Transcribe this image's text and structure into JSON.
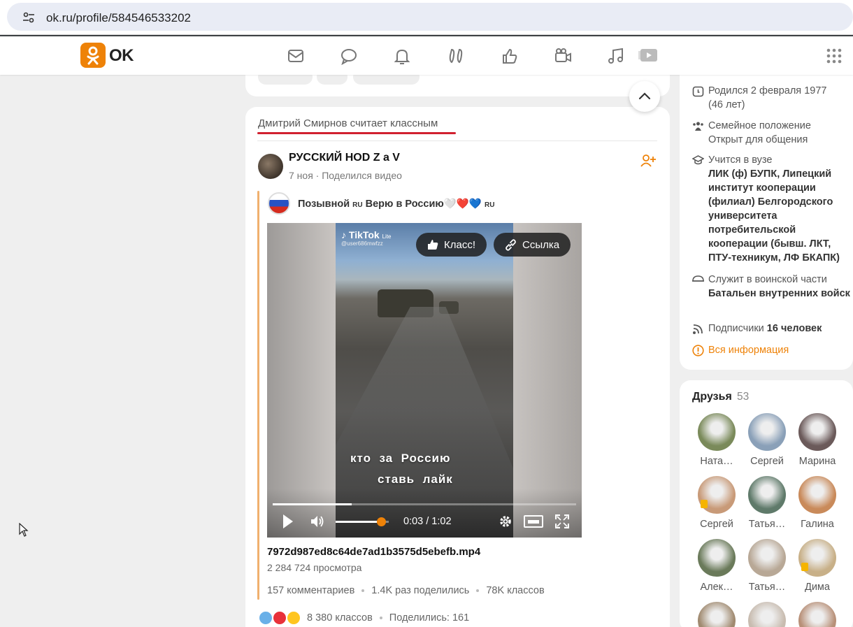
{
  "browser": {
    "url": "ok.ru/profile/584546533202",
    "site_settings_icon": "tune-icon"
  },
  "header": {
    "logo_text": "OK",
    "brand_color": "#ee8208",
    "nav_icons": [
      "messages-icon",
      "discussions-icon",
      "notifications-icon",
      "guests-icon",
      "events-icon",
      "friends-video-icon",
      "music-icon",
      "video-icon"
    ],
    "apps_icon": "apps-grid-icon"
  },
  "post": {
    "context_label": "Дмитрий Смирнов считает классным",
    "author": "РУССКИЙ HOD Z a V",
    "date": "7 ноя",
    "action": "Поделился видео",
    "repost": {
      "author_prefix": "Позывной",
      "author_sup1": "RU",
      "author_main": "Верю в Россию",
      "author_hearts": "🤍❤️💙",
      "author_sup2": "RU"
    },
    "video": {
      "watermark": "TikTok",
      "watermark_sub": "Lite",
      "watermark_user": "@user686mwfzz",
      "like_button": "Класс!",
      "link_button": "Ссылка",
      "caption_line1": "кто  за  Россию",
      "caption_line2": "ставь  лайк",
      "time": "0:03 / 1:02",
      "progress": 0.26,
      "volume": 0.85
    },
    "filename": "7972d987ed8c64de7ad1b3575d5ebefb.mp4",
    "views": "2 284 724 просмотра",
    "comments": "157 комментариев",
    "shares": "1.4K раз поделились",
    "likes": "78K классов",
    "klass_total": "8 380 классов",
    "shared_count": "Поделились: 161"
  },
  "profile_info": {
    "born": "Родился 2 февраля 1977",
    "age": "(46 лет)",
    "family_label": "Семейное положение",
    "family_value": "Открыт для общения",
    "study_label": "Учится в вузе",
    "study_value": "ЛИК (ф) БУПК, Липецкий институт кооперации (филиал) Белгородского университета потребительской кооперации (бывш. ЛКТ, ПТУ-техникум, ЛФ БКАПК)",
    "army_label": "Служит в воинской части",
    "army_value": "Батальен внутренних войск",
    "subs_label": "Подписчики",
    "subs_value": "16 человек",
    "all_info": "Вся информация"
  },
  "friends": {
    "title": "Друзья",
    "count": "53",
    "items": [
      {
        "name": "Ната…",
        "color": "#7a8a5a"
      },
      {
        "name": "Сергей",
        "color": "#8aa0b8"
      },
      {
        "name": "Марина",
        "color": "#6b5a5a"
      },
      {
        "name": "Сергей",
        "color": "#c89a78"
      },
      {
        "name": "Татья…",
        "color": "#5f7a6a"
      },
      {
        "name": "Галина",
        "color": "#c98a5a"
      },
      {
        "name": "Алек…",
        "color": "#6a7a5a"
      },
      {
        "name": "Татья…",
        "color": "#b8a896"
      },
      {
        "name": "Дима",
        "color": "#c8b088"
      },
      {
        "name": "",
        "color": "#a08a70"
      },
      {
        "name": "",
        "color": "#c8bcb0"
      },
      {
        "name": "",
        "color": "#b89078"
      }
    ]
  }
}
